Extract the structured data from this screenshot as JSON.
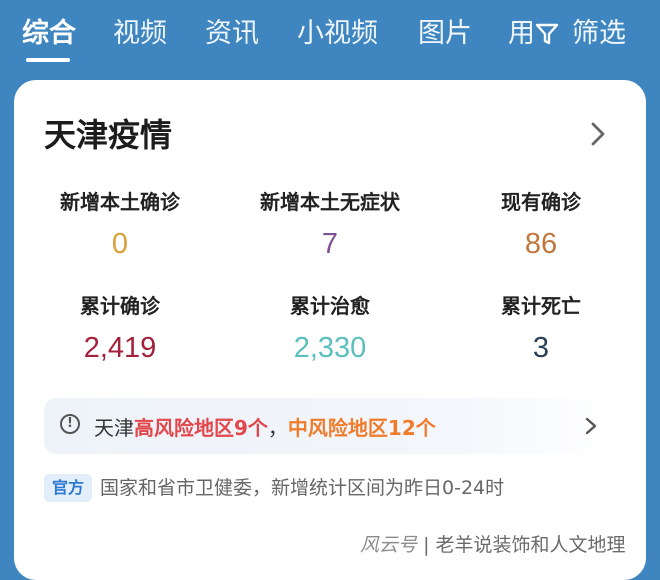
{
  "tabs": [
    {
      "label": "综合",
      "active": true
    },
    {
      "label": "视频",
      "active": false
    },
    {
      "label": "资讯",
      "active": false
    },
    {
      "label": "小视频",
      "active": false
    },
    {
      "label": "图片",
      "active": false
    },
    {
      "label": "用",
      "active": false
    }
  ],
  "filter": {
    "label": "筛选",
    "icon": "filter-funnel-icon"
  },
  "card": {
    "title": "天津疫情",
    "stats": [
      {
        "label": "新增本土确诊",
        "value": "0",
        "color": "#d8a13a"
      },
      {
        "label": "新增本土无症状",
        "value": "7",
        "color": "#7f4e96"
      },
      {
        "label": "现有确诊",
        "value": "86",
        "color": "#c0763c"
      },
      {
        "label": "累计确诊",
        "value": "2,419",
        "color": "#a3213a"
      },
      {
        "label": "累计治愈",
        "value": "2,330",
        "color": "#5bbfbd"
      },
      {
        "label": "累计死亡",
        "value": "3",
        "color": "#2b3f57"
      }
    ],
    "risk": {
      "prefix": "天津",
      "high": "高风险地区9个",
      "separator": "，",
      "mid": "中风险地区12个",
      "high_color": "#e2474b",
      "mid_color": "#f07c2b"
    },
    "official_badge": "官方",
    "source": "国家和省市卫健委，新增统计区间为昨日0-24时"
  },
  "watermark": {
    "brand": "风云号",
    "divider": "|",
    "author": "老羊说装饰和人文地理"
  }
}
